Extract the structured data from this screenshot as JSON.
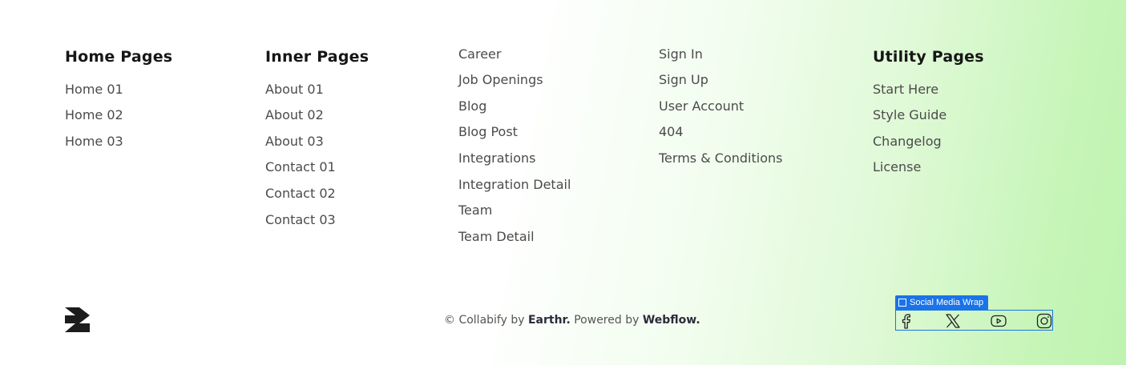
{
  "columns": {
    "home": {
      "title": "Home Pages",
      "links": [
        "Home 01",
        "Home 02",
        "Home 03"
      ]
    },
    "inner": {
      "title": "Inner Pages",
      "links": [
        "About 01",
        "About 02",
        "About 03",
        "Contact 01",
        "Contact 02",
        "Contact 03"
      ]
    },
    "pages_a": {
      "links": [
        "Career",
        "Job Openings",
        "Blog",
        "Blog Post",
        "Integrations",
        "Integration Detail",
        "Team",
        "Team Detail"
      ]
    },
    "pages_b": {
      "links": [
        "Sign In",
        "Sign Up",
        "User Account",
        "404",
        "Terms & Conditions"
      ]
    },
    "utility": {
      "title": "Utility Pages",
      "links": [
        "Start Here",
        "Style Guide",
        "Changelog",
        "License"
      ]
    }
  },
  "footer": {
    "copyright_prefix": "© Collabify by",
    "brand": "Earthr.",
    "powered_prefix": "Powered by",
    "platform": "Webflow.",
    "social_tag_label": "Social Media Wrap",
    "social_icons": [
      "facebook-icon",
      "x-icon",
      "youtube-icon",
      "instagram-icon"
    ]
  }
}
